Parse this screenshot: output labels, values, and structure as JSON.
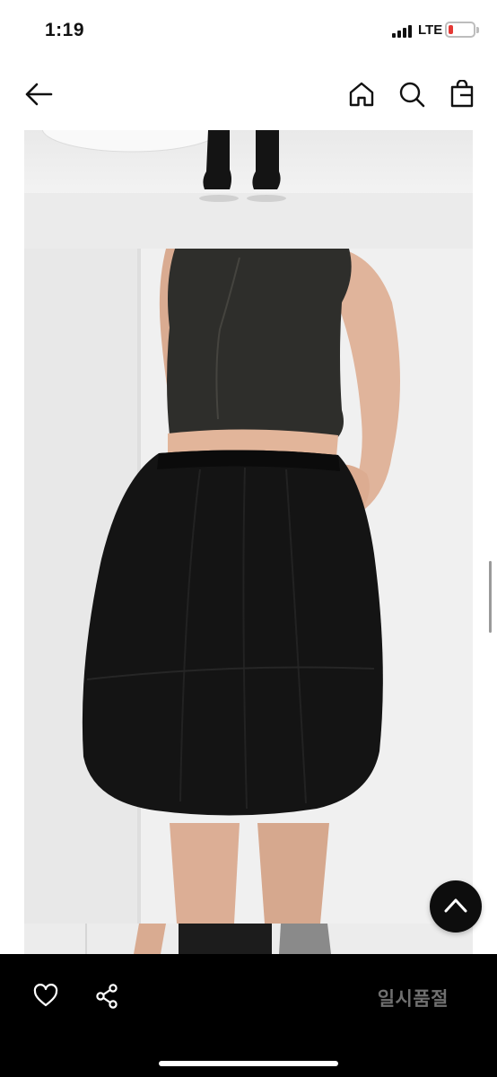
{
  "status_bar": {
    "time": "1:19",
    "network": "LTE",
    "battery_color": "#e53935"
  },
  "header": {
    "back_icon": "arrow-left-icon",
    "home_icon": "home-icon",
    "search_icon": "search-icon",
    "bag_icon": "shopping-bag-icon"
  },
  "content": {
    "images": [
      "product-photo-boots",
      "product-photo-knit-top-black-skirt",
      "product-photo-boots-partial"
    ]
  },
  "actions": {
    "scroll_top_icon": "chevron-up-icon",
    "like_icon": "heart-icon",
    "share_icon": "share-icon",
    "status_label": "일시품절"
  },
  "colors": {
    "bottom_bar": "#000000",
    "status_label": "#707070"
  }
}
